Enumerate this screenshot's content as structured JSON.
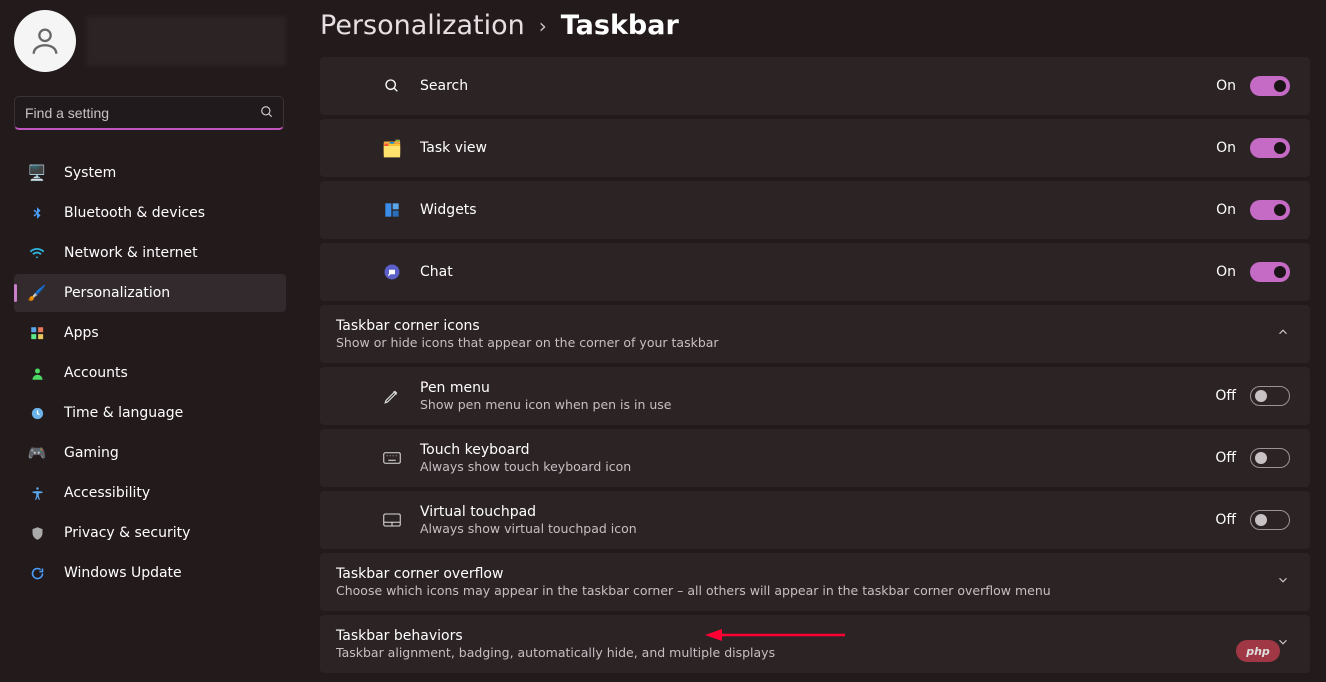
{
  "sidebar": {
    "search_placeholder": "Find a setting",
    "items": [
      {
        "label": "System"
      },
      {
        "label": "Bluetooth & devices"
      },
      {
        "label": "Network & internet"
      },
      {
        "label": "Personalization"
      },
      {
        "label": "Apps"
      },
      {
        "label": "Accounts"
      },
      {
        "label": "Time & language"
      },
      {
        "label": "Gaming"
      },
      {
        "label": "Accessibility"
      },
      {
        "label": "Privacy & security"
      },
      {
        "label": "Windows Update"
      }
    ]
  },
  "breadcrumb": {
    "parent": "Personalization",
    "current": "Taskbar"
  },
  "taskbar_items": {
    "search": {
      "label": "Search",
      "state": "On"
    },
    "taskview": {
      "label": "Task view",
      "state": "On"
    },
    "widgets": {
      "label": "Widgets",
      "state": "On"
    },
    "chat": {
      "label": "Chat",
      "state": "On"
    }
  },
  "corner_icons": {
    "title": "Taskbar corner icons",
    "subtitle": "Show or hide icons that appear on the corner of your taskbar",
    "pen": {
      "title": "Pen menu",
      "sub": "Show pen menu icon when pen is in use",
      "state": "Off"
    },
    "touch": {
      "title": "Touch keyboard",
      "sub": "Always show touch keyboard icon",
      "state": "Off"
    },
    "vtouch": {
      "title": "Virtual touchpad",
      "sub": "Always show virtual touchpad icon",
      "state": "Off"
    }
  },
  "overflow": {
    "title": "Taskbar corner overflow",
    "subtitle": "Choose which icons may appear in the taskbar corner – all others will appear in the taskbar corner overflow menu"
  },
  "behaviors": {
    "title": "Taskbar behaviors",
    "subtitle": "Taskbar alignment, badging, automatically hide, and multiple displays"
  },
  "watermark": "php"
}
